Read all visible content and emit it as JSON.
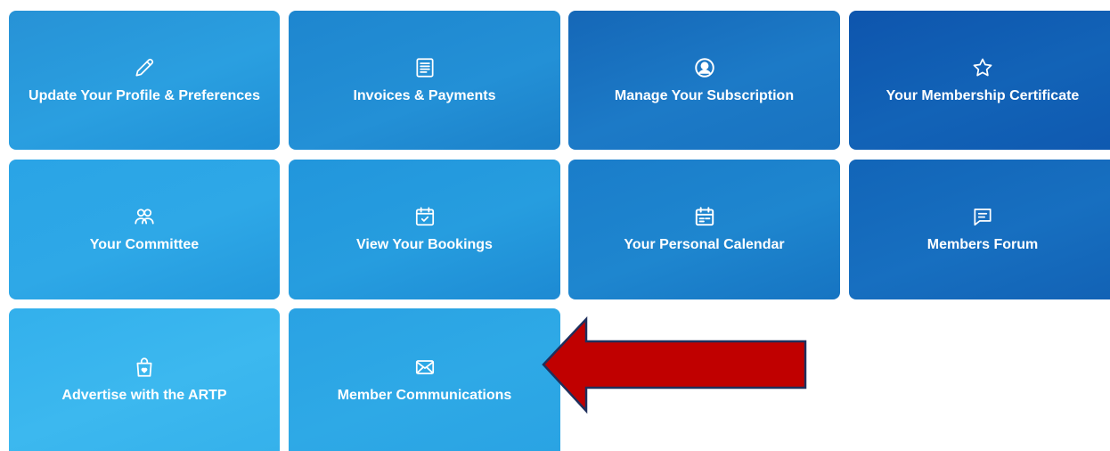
{
  "tiles": [
    {
      "label": "Update Your Profile & Preferences",
      "icon": "pencil-icon"
    },
    {
      "label": "Invoices & Payments",
      "icon": "invoice-icon"
    },
    {
      "label": "Manage Your Subscription",
      "icon": "user-circle-icon"
    },
    {
      "label": "Your Membership Certificate",
      "icon": "star-icon"
    },
    {
      "label": "Your Committee",
      "icon": "users-icon"
    },
    {
      "label": "View Your Bookings",
      "icon": "calendar-check-icon"
    },
    {
      "label": "Your Personal Calendar",
      "icon": "calendar-icon"
    },
    {
      "label": "Members Forum",
      "icon": "chat-icon"
    },
    {
      "label": "Advertise with the ARTP",
      "icon": "shopping-bag-icon"
    },
    {
      "label": "Member Communications",
      "icon": "envelope-icon"
    }
  ],
  "colors": {
    "tile_text": "#ffffff",
    "arrow_fill": "#c00000",
    "arrow_stroke": "#1f2f5c"
  }
}
